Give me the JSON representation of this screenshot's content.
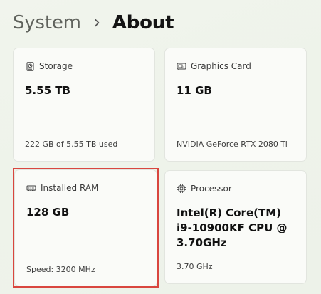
{
  "breadcrumb": {
    "parent": "System",
    "current": "About"
  },
  "cards": {
    "storage": {
      "icon": "storage-icon",
      "label": "Storage",
      "value": "5.55 TB",
      "detail": "222 GB of 5.55 TB used"
    },
    "graphics": {
      "icon": "graphics-card-icon",
      "label": "Graphics Card",
      "value": "11 GB",
      "detail": "NVIDIA GeForce RTX 2080 Ti"
    },
    "ram": {
      "icon": "memory-icon",
      "label": "Installed RAM",
      "value": "128 GB",
      "detail": "Speed: 3200 MHz"
    },
    "processor": {
      "icon": "processor-icon",
      "label": "Processor",
      "value": "Intel(R) Core(TM) i9-10900KF CPU @ 3.70GHz",
      "detail": "3.70 GHz"
    }
  },
  "colors": {
    "highlight": "#d9463f",
    "background": "#eef3ea"
  }
}
